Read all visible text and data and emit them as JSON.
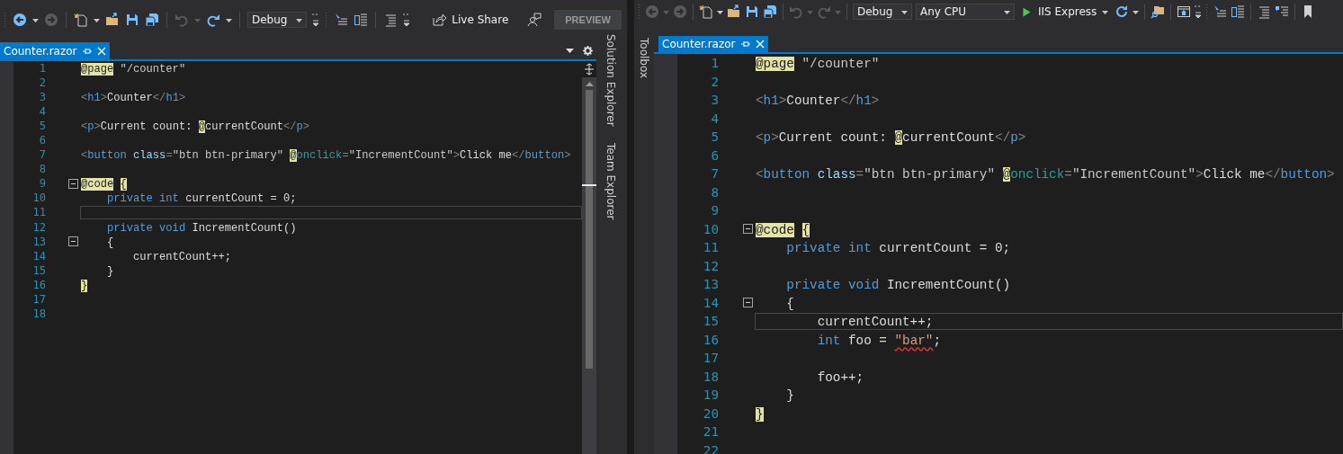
{
  "windows": [
    {
      "toolbar": [
        {
          "kind": "grip",
          "disabled": false
        },
        {
          "kind": "back",
          "disabled": false
        },
        {
          "kind": "caret",
          "disabled": false
        },
        {
          "kind": "forward",
          "disabled": true
        },
        {
          "kind": "separator",
          "disabled": false
        },
        {
          "kind": "new-item",
          "disabled": false
        },
        {
          "kind": "caret",
          "disabled": false
        },
        {
          "kind": "open",
          "disabled": false
        },
        {
          "kind": "save",
          "disabled": false
        },
        {
          "kind": "save-all",
          "disabled": false
        },
        {
          "kind": "separator",
          "disabled": false
        },
        {
          "kind": "undo",
          "disabled": true
        },
        {
          "kind": "caret",
          "disabled": true
        },
        {
          "kind": "redo",
          "disabled": false
        },
        {
          "kind": "caret",
          "disabled": false
        },
        {
          "kind": "separator",
          "disabled": false
        },
        {
          "kind": "dropdown",
          "text": "Debug",
          "disabled": false
        },
        {
          "kind": "overflow",
          "disabled": false
        },
        {
          "kind": "grip",
          "disabled": false
        },
        {
          "kind": "cursor-lines",
          "disabled": false
        },
        {
          "kind": "document-list",
          "disabled": false
        },
        {
          "kind": "separator",
          "disabled": false
        },
        {
          "kind": "align-lines",
          "disabled": false
        },
        {
          "kind": "overflow",
          "disabled": false
        },
        {
          "kind": "share-button",
          "text": "Live Share",
          "disabled": false
        },
        {
          "kind": "feedback",
          "disabled": false
        },
        {
          "kind": "preview-button",
          "text": "PREVIEW",
          "disabled": false
        }
      ],
      "tabs": [
        {
          "label": "Counter.razor",
          "selected": true
        }
      ],
      "tab_tools": true,
      "scrollbar": true,
      "right_strip": [
        "Solution Explorer",
        "Team Explorer"
      ],
      "lines": [
        {
          "number": "1",
          "fold": false,
          "current": false,
          "tokens": [
            {
              "kind": "razor",
              "text": "@page "
            },
            {
              "kind": "value",
              "text": "\"/counter\""
            }
          ]
        },
        {
          "number": "2",
          "fold": false,
          "current": false
        },
        {
          "number": "3",
          "fold": false,
          "current": false,
          "tokens": [
            {
              "kind": "punct",
              "text": "<"
            },
            {
              "kind": "tag",
              "text": "h1"
            },
            {
              "kind": "punct",
              "text": ">"
            },
            {
              "kind": "text",
              "text": "Counter"
            },
            {
              "kind": "punct",
              "text": "</"
            },
            {
              "kind": "tag",
              "text": "h1"
            },
            {
              "kind": "punct",
              "text": ">"
            }
          ]
        },
        {
          "number": "4",
          "fold": false,
          "current": false
        },
        {
          "number": "5",
          "fold": false,
          "current": false,
          "tokens": [
            {
              "kind": "punct",
              "text": "<"
            },
            {
              "kind": "tag",
              "text": "p"
            },
            {
              "kind": "punct",
              "text": ">"
            },
            {
              "kind": "text",
              "text": "Current count: "
            },
            {
              "kind": "razor",
              "text": "@"
            },
            {
              "kind": "text",
              "text": "currentCount"
            },
            {
              "kind": "punct",
              "text": "</"
            },
            {
              "kind": "tag",
              "text": "p"
            },
            {
              "kind": "punct",
              "text": ">"
            }
          ]
        },
        {
          "number": "6",
          "fold": false,
          "current": false
        },
        {
          "number": "7",
          "fold": false,
          "current": false,
          "tokens": [
            {
              "kind": "punct",
              "text": "<"
            },
            {
              "kind": "tag",
              "text": "button "
            },
            {
              "kind": "attr",
              "text": "class"
            },
            {
              "kind": "punct",
              "text": "="
            },
            {
              "kind": "value",
              "text": "\"btn btn-primary\" "
            },
            {
              "kind": "razor",
              "text": "@"
            },
            {
              "kind": "directive",
              "text": "onclick"
            },
            {
              "kind": "punct",
              "text": "="
            },
            {
              "kind": "value",
              "text": "\"IncrementCount\""
            },
            {
              "kind": "punct",
              "text": ">"
            },
            {
              "kind": "text",
              "text": "Click me"
            },
            {
              "kind": "punct",
              "text": "</"
            },
            {
              "kind": "tag",
              "text": "button"
            },
            {
              "kind": "punct",
              "text": ">"
            }
          ]
        },
        {
          "number": "8",
          "fold": false,
          "current": false
        },
        {
          "number": "9",
          "fold": true,
          "current": false,
          "tokens": [
            {
              "kind": "razor",
              "text": "@code "
            },
            {
              "kind": "razor",
              "text": "{"
            }
          ]
        },
        {
          "number": "10",
          "fold": false,
          "current": false,
          "tokens": [
            {
              "kind": "keyword",
              "text": "    private "
            },
            {
              "kind": "keyword",
              "text": "int"
            },
            {
              "kind": "text",
              "text": " currentCount = 0;"
            }
          ]
        },
        {
          "number": "11",
          "fold": false,
          "current": true
        },
        {
          "number": "12",
          "fold": false,
          "current": false,
          "tokens": [
            {
              "kind": "keyword",
              "text": "    private "
            },
            {
              "kind": "keyword",
              "text": "void"
            },
            {
              "kind": "text",
              "text": " IncrementCount()"
            }
          ]
        },
        {
          "number": "13",
          "fold": true,
          "current": false,
          "tokens": [
            {
              "kind": "text",
              "text": "    {"
            }
          ]
        },
        {
          "number": "14",
          "fold": false,
          "current": false,
          "tokens": [
            {
              "kind": "text",
              "text": "        currentCount++;"
            }
          ]
        },
        {
          "number": "15",
          "fold": false,
          "current": false,
          "tokens": [
            {
              "kind": "text",
              "text": "    }"
            }
          ]
        },
        {
          "number": "16",
          "fold": false,
          "current": false,
          "tokens": [
            {
              "kind": "razor",
              "text": "}"
            }
          ]
        },
        {
          "number": "17",
          "fold": false,
          "current": false
        },
        {
          "number": "18",
          "fold": false,
          "current": false
        }
      ]
    },
    {
      "toolbar": [
        {
          "kind": "grip",
          "disabled": false
        },
        {
          "kind": "back",
          "disabled": true
        },
        {
          "kind": "caret",
          "disabled": true
        },
        {
          "kind": "forward",
          "disabled": true
        },
        {
          "kind": "separator",
          "disabled": false
        },
        {
          "kind": "new-item",
          "disabled": false
        },
        {
          "kind": "caret",
          "disabled": false
        },
        {
          "kind": "open",
          "disabled": false
        },
        {
          "kind": "save",
          "disabled": false
        },
        {
          "kind": "save-all",
          "disabled": false
        },
        {
          "kind": "separator",
          "disabled": false
        },
        {
          "kind": "undo",
          "disabled": true
        },
        {
          "kind": "caret",
          "disabled": true
        },
        {
          "kind": "redo",
          "disabled": true
        },
        {
          "kind": "caret",
          "disabled": true
        },
        {
          "kind": "separator",
          "disabled": false
        },
        {
          "kind": "dropdown",
          "text": "Debug",
          "disabled": false
        },
        {
          "kind": "wide-dropdown",
          "text": "Any CPU",
          "disabled": false
        },
        {
          "kind": "run-button",
          "text": "IIS Express",
          "disabled": false
        },
        {
          "kind": "refresh",
          "disabled": false
        },
        {
          "kind": "caret",
          "disabled": false
        },
        {
          "kind": "separator",
          "disabled": false
        },
        {
          "kind": "folder-search",
          "disabled": false
        },
        {
          "kind": "separator",
          "disabled": false
        },
        {
          "kind": "browser",
          "disabled": false
        },
        {
          "kind": "overflow",
          "disabled": false
        },
        {
          "kind": "grip",
          "disabled": false
        },
        {
          "kind": "cursor-lines",
          "disabled": false
        },
        {
          "kind": "document-list",
          "disabled": false
        },
        {
          "kind": "separator",
          "disabled": false
        },
        {
          "kind": "align-lines",
          "disabled": false
        },
        {
          "kind": "comment-lines",
          "disabled": false
        },
        {
          "kind": "separator",
          "disabled": false
        },
        {
          "kind": "bookmark",
          "disabled": false
        }
      ],
      "tabs": [
        {
          "label": "Counter.razor",
          "selected": true
        }
      ],
      "tab_tools": false,
      "scrollbar": false,
      "left_strip": [
        "Toolbox"
      ],
      "lines": [
        {
          "number": "1",
          "fold": false,
          "current": false,
          "tokens": [
            {
              "kind": "razor",
              "text": "@page "
            },
            {
              "kind": "value",
              "text": "\"/counter\""
            }
          ]
        },
        {
          "number": "2",
          "fold": false,
          "current": false
        },
        {
          "number": "3",
          "fold": false,
          "current": false,
          "tokens": [
            {
              "kind": "punct",
              "text": "<"
            },
            {
              "kind": "tag",
              "text": "h1"
            },
            {
              "kind": "punct",
              "text": ">"
            },
            {
              "kind": "text",
              "text": "Counter"
            },
            {
              "kind": "punct",
              "text": "</"
            },
            {
              "kind": "tag",
              "text": "h1"
            },
            {
              "kind": "punct",
              "text": ">"
            }
          ]
        },
        {
          "number": "4",
          "fold": false,
          "current": false
        },
        {
          "number": "5",
          "fold": false,
          "current": false,
          "tokens": [
            {
              "kind": "punct",
              "text": "<"
            },
            {
              "kind": "tag",
              "text": "p"
            },
            {
              "kind": "punct",
              "text": ">"
            },
            {
              "kind": "text",
              "text": "Current count: "
            },
            {
              "kind": "razor",
              "text": "@"
            },
            {
              "kind": "text",
              "text": "currentCount"
            },
            {
              "kind": "punct",
              "text": "</"
            },
            {
              "kind": "tag",
              "text": "p"
            },
            {
              "kind": "punct",
              "text": ">"
            }
          ]
        },
        {
          "number": "6",
          "fold": false,
          "current": false
        },
        {
          "number": "7",
          "fold": false,
          "current": false,
          "tokens": [
            {
              "kind": "punct",
              "text": "<"
            },
            {
              "kind": "tag",
              "text": "button "
            },
            {
              "kind": "attr",
              "text": "class"
            },
            {
              "kind": "punct",
              "text": "="
            },
            {
              "kind": "value",
              "text": "\"btn btn-primary\" "
            },
            {
              "kind": "razor",
              "text": "@"
            },
            {
              "kind": "directive",
              "text": "onclick"
            },
            {
              "kind": "punct",
              "text": "="
            },
            {
              "kind": "value",
              "text": "\"IncrementCount\""
            },
            {
              "kind": "punct",
              "text": ">"
            },
            {
              "kind": "text",
              "text": "Click me"
            },
            {
              "kind": "punct",
              "text": "</"
            },
            {
              "kind": "tag",
              "text": "button"
            },
            {
              "kind": "punct",
              "text": ">"
            }
          ]
        },
        {
          "number": "8",
          "fold": false,
          "current": false
        },
        {
          "number": "9",
          "fold": false,
          "current": false
        },
        {
          "number": "10",
          "fold": true,
          "current": false,
          "tokens": [
            {
              "kind": "razor",
              "text": "@code "
            },
            {
              "kind": "razor",
              "text": "{"
            }
          ]
        },
        {
          "number": "11",
          "fold": false,
          "current": false,
          "tokens": [
            {
              "kind": "keyword",
              "text": "    private "
            },
            {
              "kind": "keyword",
              "text": "int"
            },
            {
              "kind": "text",
              "text": " currentCount = 0;"
            }
          ]
        },
        {
          "number": "12",
          "fold": false,
          "current": false
        },
        {
          "number": "13",
          "fold": false,
          "current": false,
          "tokens": [
            {
              "kind": "keyword",
              "text": "    private "
            },
            {
              "kind": "keyword",
              "text": "void"
            },
            {
              "kind": "text",
              "text": " IncrementCount()"
            }
          ]
        },
        {
          "number": "14",
          "fold": true,
          "current": false,
          "tokens": [
            {
              "kind": "text",
              "text": "    {"
            }
          ]
        },
        {
          "number": "15",
          "fold": false,
          "current": true,
          "tokens": [
            {
              "kind": "text",
              "text": "        currentCount++;"
            }
          ]
        },
        {
          "number": "16",
          "fold": false,
          "current": false,
          "tokens": [
            {
              "kind": "keyword",
              "text": "        int"
            },
            {
              "kind": "text",
              "text": " foo = "
            },
            {
              "kind": "error-string",
              "text": "\"bar\""
            },
            {
              "kind": "text",
              "text": ";"
            }
          ]
        },
        {
          "number": "17",
          "fold": false,
          "current": false
        },
        {
          "number": "18",
          "fold": false,
          "current": false,
          "tokens": [
            {
              "kind": "text",
              "text": "        foo++;"
            }
          ]
        },
        {
          "number": "19",
          "fold": false,
          "current": false,
          "tokens": [
            {
              "kind": "text",
              "text": "    }"
            }
          ]
        },
        {
          "number": "20",
          "fold": false,
          "current": false,
          "tokens": [
            {
              "kind": "razor",
              "text": "}"
            }
          ]
        },
        {
          "number": "21",
          "fold": false,
          "current": false
        },
        {
          "number": "22",
          "fold": false,
          "current": false
        }
      ]
    }
  ]
}
